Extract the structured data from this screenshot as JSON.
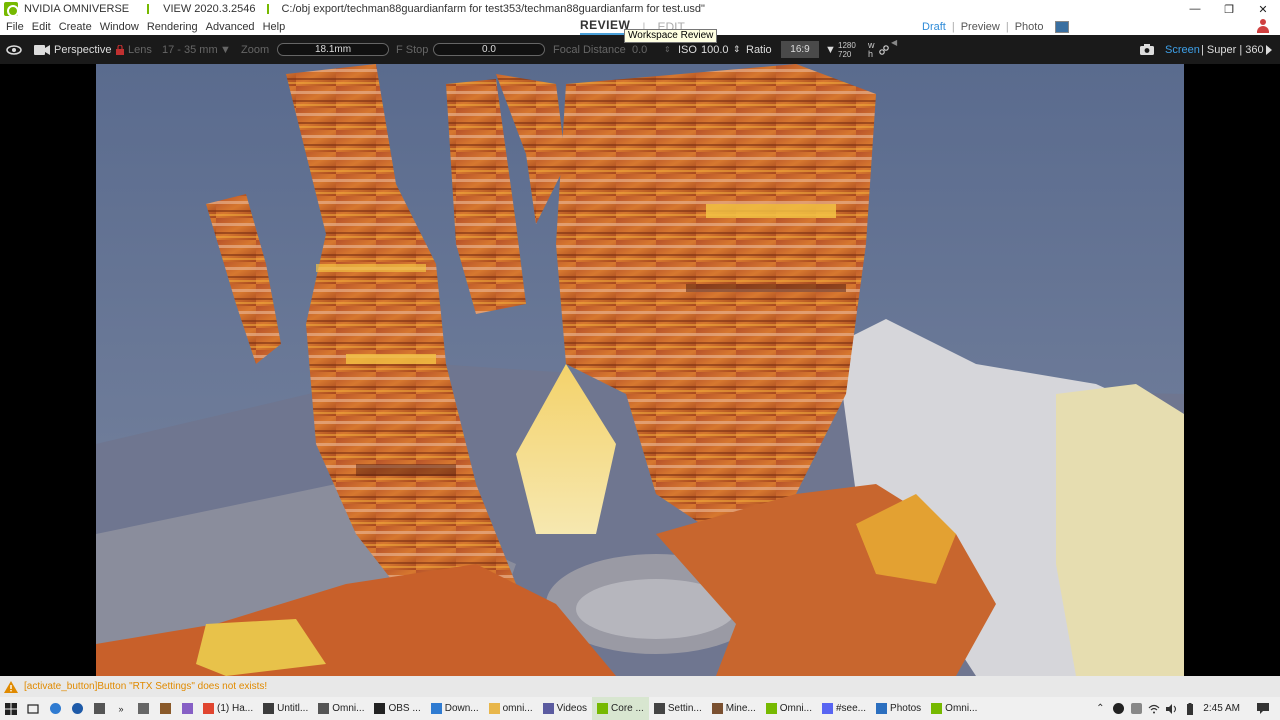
{
  "titlebar": {
    "app_name": "NVIDIA OMNIVERSE",
    "version": "VIEW 2020.3.2546",
    "file_path": "C:/obj export/techman88guardianfarm for test353/techman88guardianfarm for test.usd\"",
    "minimize": "—",
    "restore": "❐",
    "close": "✕"
  },
  "menubar": {
    "items": [
      "File",
      "Edit",
      "Create",
      "Window",
      "Rendering",
      "Advanced",
      "Help"
    ],
    "mode_review": "REVIEW",
    "mode_edit": "EDIT",
    "render_modes": [
      "Draft",
      "Preview",
      "Photo"
    ],
    "render_divider": "|"
  },
  "tooltip": {
    "text": "Workspace Review"
  },
  "camtoolbar": {
    "perspective": "Perspective",
    "lens_label": "Lens",
    "lens_value": "17 - 35 mm",
    "zoom_label": "Zoom",
    "zoom_value": "18.1mm",
    "fstop_label": "F Stop",
    "fstop_value": "0.0",
    "focal_label": "Focal Distance",
    "focal_value": "0.0",
    "iso_label": "ISO",
    "iso_value": "100.0",
    "ratio_label": "Ratio",
    "ratio_value": "16:9",
    "res_width": "1280",
    "res_height": "720",
    "w_label": "w",
    "h_label": "h",
    "screen_label": "Screen",
    "quality_label": "| Super | 360"
  },
  "console": {
    "message": "[activate_button]Button \"RTX Settings\" does not exists!"
  },
  "taskbar": {
    "apps": [
      {
        "label": "(1) Ha...",
        "color": "#e0452f"
      },
      {
        "label": "Untitl...",
        "color": "#3c3c3c"
      },
      {
        "label": "Omni...",
        "color": "#555555"
      },
      {
        "label": "OBS ...",
        "color": "#222222"
      },
      {
        "label": "Down...",
        "color": "#2f7bd1"
      },
      {
        "label": "omni...",
        "color": "#e8b64a"
      },
      {
        "label": "Videos",
        "color": "#5b5ba0"
      },
      {
        "label": "Core ...",
        "color": "#76b900"
      },
      {
        "label": "Settin...",
        "color": "#444444"
      },
      {
        "label": "Mine...",
        "color": "#7a5030"
      },
      {
        "label": "Omni...",
        "color": "#76b900"
      },
      {
        "label": "#see...",
        "color": "#5865f2"
      },
      {
        "label": "Photos",
        "color": "#2b6fbf"
      },
      {
        "label": "Omni...",
        "color": "#76b900"
      }
    ],
    "clock": "2:45 AM"
  },
  "colors": {
    "accent_blue": "#2e8bd8",
    "nvidia_green": "#76b900",
    "warning_orange": "#e08a00",
    "sky": "#5c6f93",
    "terrain_orange": "#c8662e",
    "snow": "#d8d8dc",
    "sand": "#e6d9a8"
  }
}
